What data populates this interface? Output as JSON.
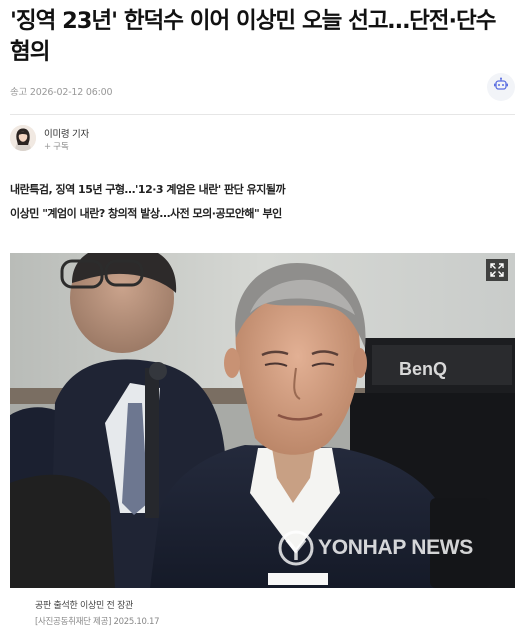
{
  "article": {
    "headline": "'징역 23년' 한덕수 이어 이상민 오늘 선고…단전·단수 혐의",
    "published": "송고 2026-02-12 06:00",
    "reporter": "이미령 기자",
    "subscribe_label": "구독",
    "summary": [
      "내란특검, 징역 15년 구형…'12·3 계엄은 내란' 판단 유지될까",
      "이상민 \"계엄이 내란? 창의적 발상…사전 모의·공모안해\" 부인"
    ]
  },
  "photo": {
    "watermark": "YONHAP NEWS",
    "monitor_brand": "BenQ",
    "caption": "공판 출석한 이상민 전 장관",
    "credit": "[사진공동취재단 제공] 2025.10.17"
  },
  "icons": {
    "bot": "robot-icon",
    "expand": "expand-icon",
    "subscribe": "plus-icon"
  },
  "colors": {
    "text": "#111111",
    "muted": "#999999",
    "divider": "#e6e6e6",
    "bot_accent": "#5b6ee1"
  }
}
